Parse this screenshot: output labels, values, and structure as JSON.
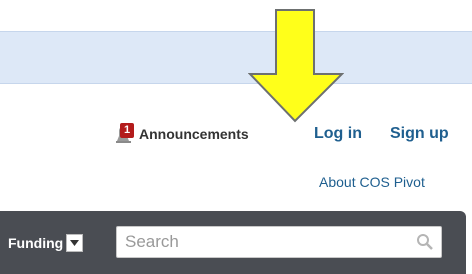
{
  "header": {
    "announcements": {
      "badge_count": "1",
      "label": "Announcements",
      "icon": "bell-icon"
    },
    "login_label": "Log in",
    "signup_label": "Sign up",
    "about_label": "About COS Pivot"
  },
  "search_bar": {
    "scope_label": "Funding",
    "placeholder": "Search",
    "value": "",
    "search_icon": "magnifier-icon"
  },
  "colors": {
    "banner": "#dde8f7",
    "link": "#1f5f8f",
    "badge": "#b31b1b",
    "search_bar": "#4a4d53",
    "arrow_fill": "#ffff1a",
    "arrow_stroke": "#6d7070"
  }
}
